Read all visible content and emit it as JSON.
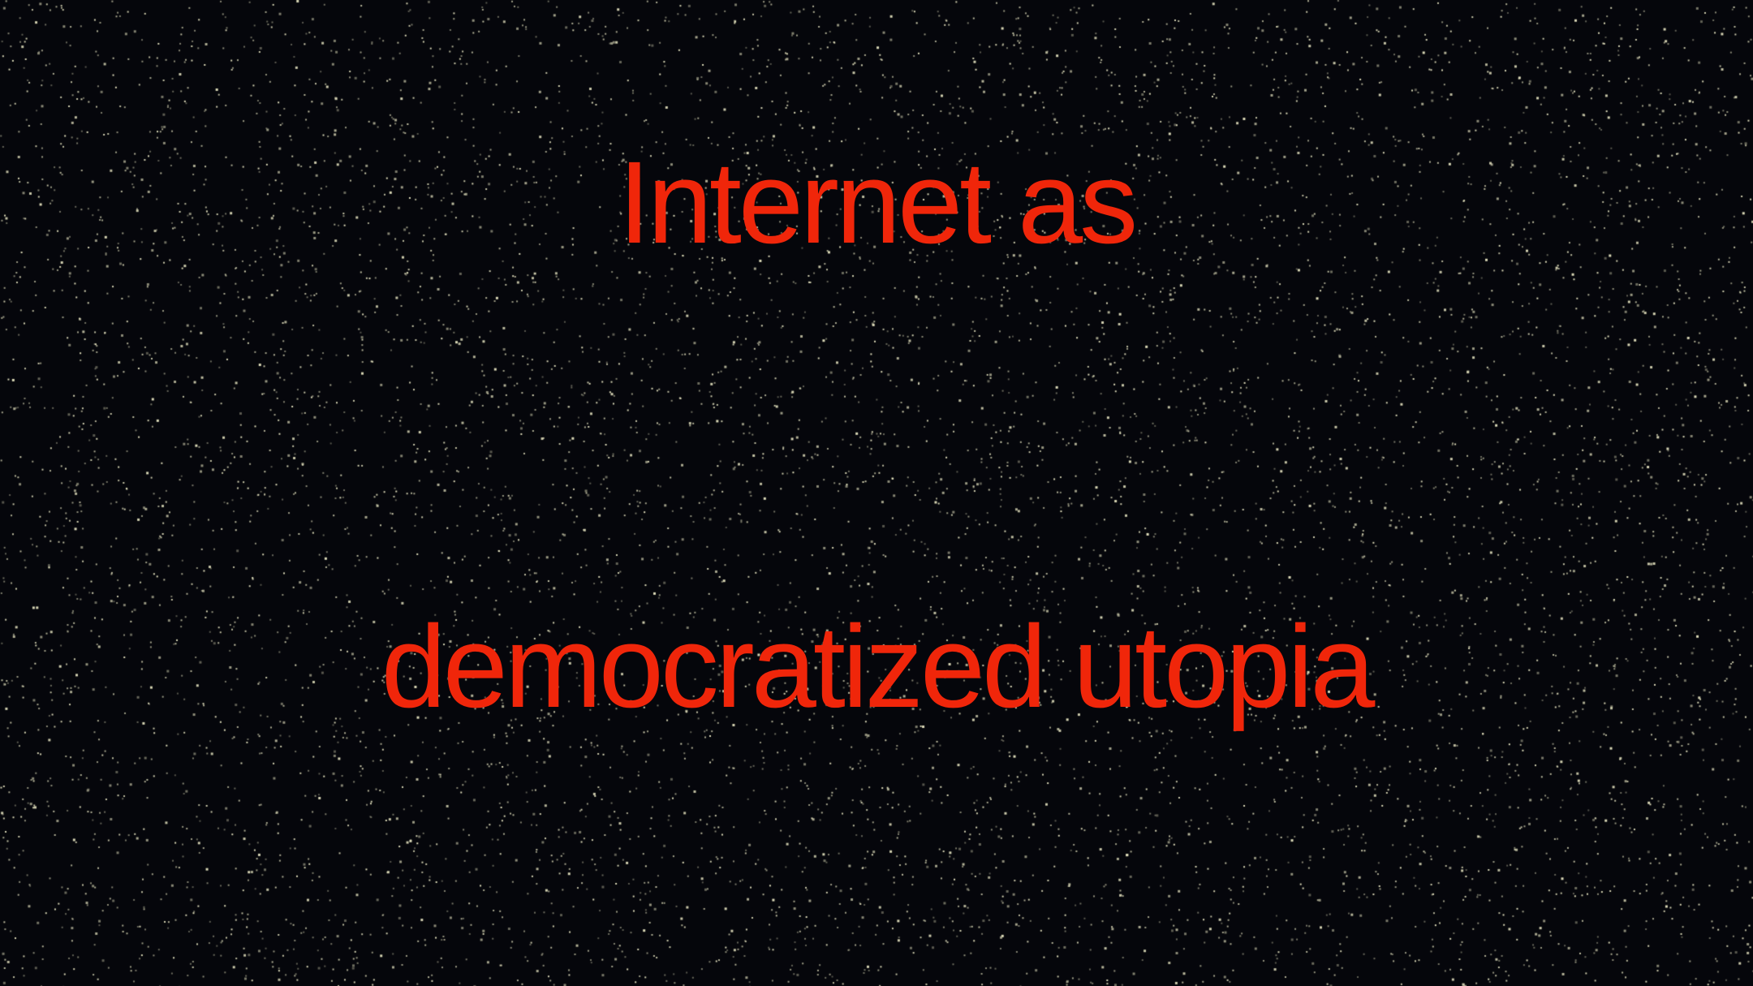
{
  "headline": {
    "line1": "Internet as",
    "line2": "democratized utopia"
  },
  "colors": {
    "background": "#05060b",
    "headline_text": "#f0260a",
    "star_dots": "#e8e6c2"
  }
}
